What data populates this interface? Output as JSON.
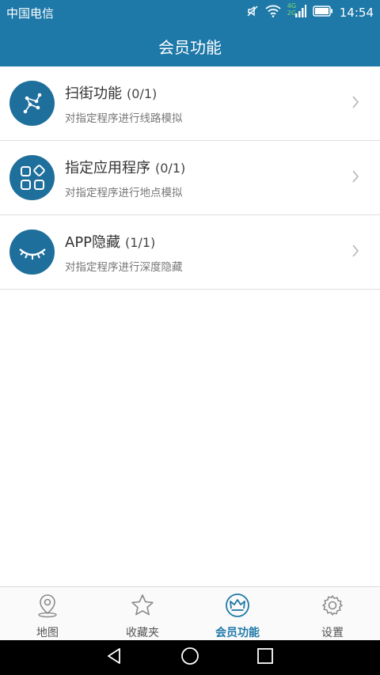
{
  "status_bar": {
    "carrier": "中国电信",
    "network": "4G 2G",
    "time": "14:54"
  },
  "header": {
    "title": "会员功能"
  },
  "features": [
    {
      "title": "扫街功能",
      "count": "(0/1)",
      "subtitle": "对指定程序进行线路模拟",
      "icon": "route-icon"
    },
    {
      "title": "指定应用程序",
      "count": "(0/1)",
      "subtitle": "对指定程序进行地点模拟",
      "icon": "apps-grid-icon"
    },
    {
      "title": "APP隐藏",
      "count": "(1/1)",
      "subtitle": "对指定程序进行深度隐藏",
      "icon": "closed-eye-icon"
    }
  ],
  "tabs": [
    {
      "label": "地图",
      "icon": "map-pin-icon",
      "active": false
    },
    {
      "label": "收藏夹",
      "icon": "star-icon",
      "active": false
    },
    {
      "label": "会员功能",
      "icon": "crown-icon",
      "active": true
    },
    {
      "label": "设置",
      "icon": "gear-icon",
      "active": false
    }
  ],
  "colors": {
    "primary": "#1e78a8",
    "badge": "#1e6f9c",
    "tab_active": "#1e78a8"
  }
}
